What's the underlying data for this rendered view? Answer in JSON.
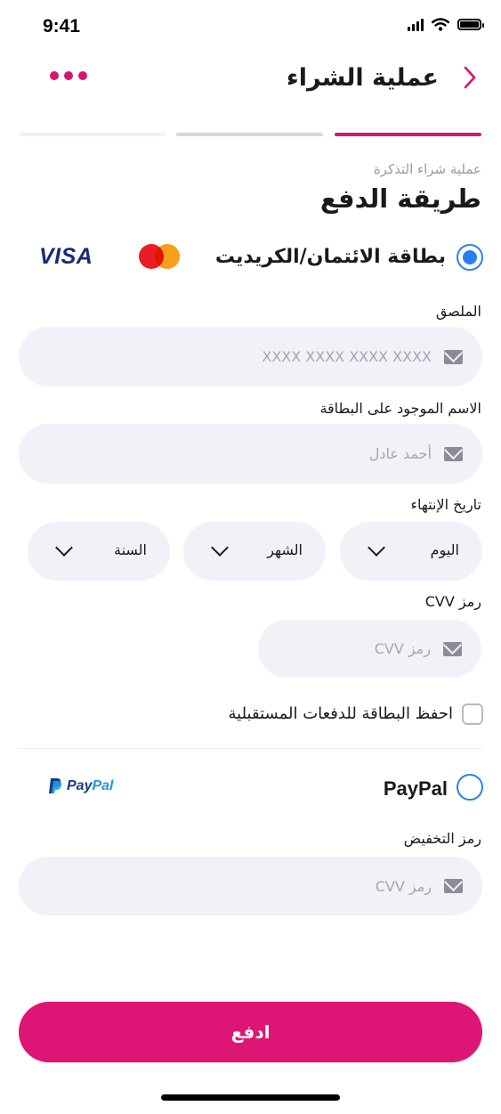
{
  "status_bar": {
    "time": "9:41",
    "icons": [
      "signal-icon",
      "wifi-icon",
      "battery-icon"
    ]
  },
  "header": {
    "title": "عملية الشراء",
    "back_icon": "chevron-right-icon",
    "more_icon": "more-dots-icon"
  },
  "steps": {
    "total": 3,
    "active": 3
  },
  "page": {
    "subtitle": "عملية شراء التذكرة",
    "title": "طريقة الدفع"
  },
  "payment_options": {
    "card": {
      "label": "بطاقة الائتمان/الكريديت",
      "selected": true,
      "brands": [
        "VISA",
        "mastercard"
      ]
    },
    "paypal": {
      "label": "PayPal",
      "selected": false,
      "logo_pay": "Pay",
      "logo_pal": "Pal"
    }
  },
  "form": {
    "card_number": {
      "label": "الملصق",
      "placeholder": "XXXX XXXX XXXX XXXX"
    },
    "card_name": {
      "label": "الاسم الموجود على البطاقة",
      "placeholder": "أحمد عادل"
    },
    "expiry": {
      "label": "تاريخ الإنتهاء",
      "day": "اليوم",
      "month": "الشهر",
      "year": "السنة"
    },
    "cvv": {
      "label": "رمز CVV",
      "placeholder": "رمز CVV"
    },
    "save_card": {
      "label": "احفظ البطاقة للدفعات المستقبلية",
      "checked": false
    },
    "discount": {
      "label": "رمز التخفيض",
      "placeholder": "رمز CVV"
    }
  },
  "actions": {
    "pay_label": "ادفع"
  },
  "colors": {
    "accent": "#dd1575",
    "radio": "#2a7ff0",
    "field_bg": "#f1f1f8"
  }
}
